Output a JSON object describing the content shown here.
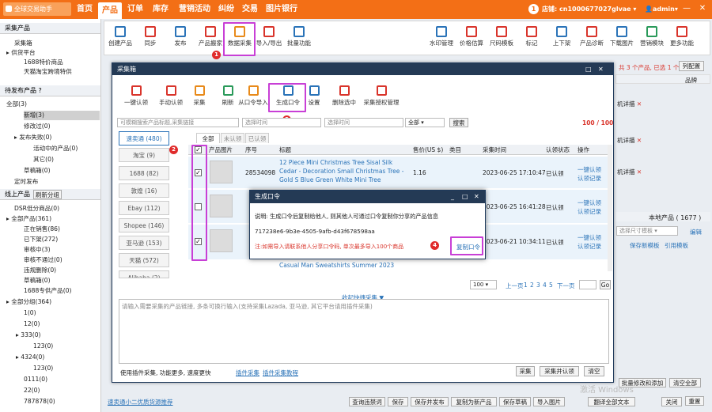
{
  "app": {
    "logo": "全球交易助手"
  },
  "nav": [
    "首页",
    "产品",
    "订单",
    "库存",
    "营销活动",
    "纠纷",
    "交易",
    "图片银行"
  ],
  "header": {
    "notif_count": "1",
    "store_label": "店铺:",
    "store_id": "cn1000677027glvae",
    "user": "admin"
  },
  "sidebar": {
    "sec1_title": "采集产品",
    "sec1_items": [
      "采集箱",
      "供货平台",
      "1688特价商品",
      "天猫淘宝跨境特供"
    ],
    "sec2_title": "待发布产品",
    "sec2_items": [
      "全部(3)",
      "新增(3)",
      "修改过(0)",
      "发布失败(0)",
      "活动中的产品(0)",
      "其它(0)",
      "草稿箱(0)",
      "定时发布"
    ],
    "sec3_title": "线上产品",
    "sec3_btn": "刷新分组",
    "sec3_items": [
      "DSR低分商品(0)",
      "全部产品(361)",
      "正在销售(86)",
      "已下架(272)",
      "审核中(3)",
      "审核不通过(0)",
      "违规删除(0)",
      "草稿箱(0)",
      "1688专供产品(0)",
      "全部分组(364)",
      "1(0)",
      "12(0)",
      "333(0)",
      "123(0)",
      "4324(0)",
      "123(0)",
      "0111(0)",
      "22(0)",
      "787878(0)"
    ]
  },
  "main_toolbar": [
    "创建产品",
    "同步",
    "发布",
    "产品搬家",
    "数据采集",
    "导入/导出",
    "批量功能",
    "水印管理",
    "价格估算",
    "尺码模板",
    "标记",
    "上下架",
    "产品诊断",
    "下载图片",
    "营销模块",
    "更多功能"
  ],
  "main_page": {
    "selected_text": "共 3 个产品, 已选 1 个",
    "column_setting": "列配置",
    "col_brand": "品牌",
    "detail_link": "机详描",
    "local_products": "本地产品 ( 1677 )",
    "size_template": "选择尺寸模板",
    "edit_link": "编辑",
    "save_new_template": "保存新模板",
    "ref_template": "引用模板",
    "bottom_left_link": "速卖通小二优质货源推荐",
    "bottom_buttons": [
      "查询违禁词",
      "保存",
      "保存并发布",
      "复制为新产品",
      "保存草稿",
      "导入图片",
      "翻译全部文本",
      "关闭"
    ],
    "batch_buttons": [
      "批量修改和添加",
      "清空全部",
      "重置"
    ],
    "watermark": "激活 Windows"
  },
  "modal": {
    "title": "采集箱",
    "toolbar": [
      "一键认领",
      "手动认领",
      "采集",
      "刷新",
      "从口令导入",
      "生成口令",
      "设置",
      "删除选中",
      "采集授权管理"
    ],
    "search_placeholder": "可模糊搜索产品标题,采集链接",
    "date_placeholder": "选择时间",
    "date_placeholder2": "选择时间",
    "platform_filter": "全部",
    "search_btn": "搜索",
    "count": "100 / 100",
    "sources": [
      "速卖通 (480)",
      "淘宝 (9)",
      "1688 (82)",
      "敦煌 (16)",
      "Ebay (112)",
      "Shopee (146)",
      "亚马逊 (153)",
      "天猫 (572)",
      "Alibaba (2)"
    ],
    "tabs": [
      "全部",
      "未认领",
      "已认领"
    ],
    "columns": [
      "产品图片",
      "序号",
      "标题",
      "售价(US $)",
      "类目",
      "采集时间",
      "认领状态",
      "操作"
    ],
    "rows": [
      {
        "id": "28534098",
        "title": "12 Piece Mini Christmas Tree Sisal Silk Cedar - Decoration Small Christmas Tree - Gold S Blue Green White Mini Tree",
        "price": "1.16",
        "time": "2023-06-25 17:10:47",
        "status": "已认领",
        "op1": "一键认领",
        "op2": "认领记录"
      },
      {
        "id": "",
        "title": "",
        "price": "",
        "time": "2023-06-25 16:41:28",
        "status": "已认领",
        "op1": "一键认领",
        "op2": "认领记录"
      },
      {
        "id": "",
        "title": "",
        "price": "",
        "time": "2023-06-21 10:34:11",
        "status": "已认领",
        "op1": "一键认领",
        "op2": "认领记录"
      },
      {
        "id": "",
        "title": "Casual Man Sweatshirts Summer 2023",
        "price": "",
        "time": "",
        "status": "",
        "op1": "",
        "op2": ""
      }
    ],
    "page_size": "100",
    "pagination": [
      "上一页",
      "1",
      "2",
      "3",
      "4",
      "5",
      "下一页"
    ],
    "go_btn": "Go",
    "quick_collect": "收起快捷采集 ▼",
    "collect_placeholder": "请输入需要采集的产品链接, 多条可换行输入(支持采集Lazada, 亚马逊, 其它平台请用插件采集)",
    "footer_text": "使用插件采集, 功能更多, 速度更快",
    "plugin_link": "插件采集",
    "plugin_tutorial": "插件采集教程",
    "footer_buttons": [
      "采集",
      "采集并认领",
      "清空"
    ]
  },
  "dialog": {
    "title": "生成口令",
    "desc": "说明: 生成口令后复制给他人, 则其他人可通过口令复制你分享的产品信息",
    "token": "717238e6-9b3e-4505-9afb-d43f678598aa",
    "note": "注:如需导入请联系他人分享口令码, 单次最多导入100个商品",
    "copy_btn": "复制口令"
  },
  "annotations": [
    "1",
    "2",
    "3",
    "4"
  ],
  "colors": {
    "brand": "#f36f16",
    "modal_header": "#243a55",
    "highlight": "#c83fd6",
    "badge": "#e02b2b",
    "link": "#2a73b8"
  }
}
